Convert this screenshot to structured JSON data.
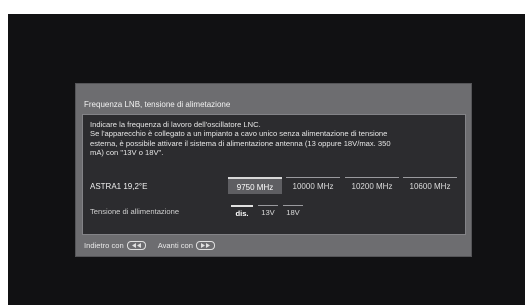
{
  "dialog": {
    "title": "Frequenza LNB, tensione di alimetazione",
    "description": [
      "Indicare la frequenza di lavoro dell'oscillatore LNC.",
      "Se l'apparecchio è collegato a un impianto a cavo unico senza alimentazione di tensione",
      "esterna, è possibile attivare il sistema di alimentazione antenna (13 oppure 18V/max. 350",
      "mA) con \"13V o 18V\"."
    ],
    "lnb": {
      "label": "ASTRA1 19,2°E",
      "options": [
        "9750 MHz",
        "10000 MHz",
        "10200 MHz",
        "10600 MHz"
      ],
      "selected": "9750 MHz"
    },
    "power": {
      "label": "Tensione di allimentazione",
      "options": [
        "dis.",
        "13V",
        "18V"
      ],
      "selected": "dis."
    },
    "footer": {
      "back_label": "Indietro con",
      "back_icon": "rewind-button-icon",
      "forward_label": "Avanti con",
      "forward_icon": "fast-forward-button-icon"
    }
  }
}
